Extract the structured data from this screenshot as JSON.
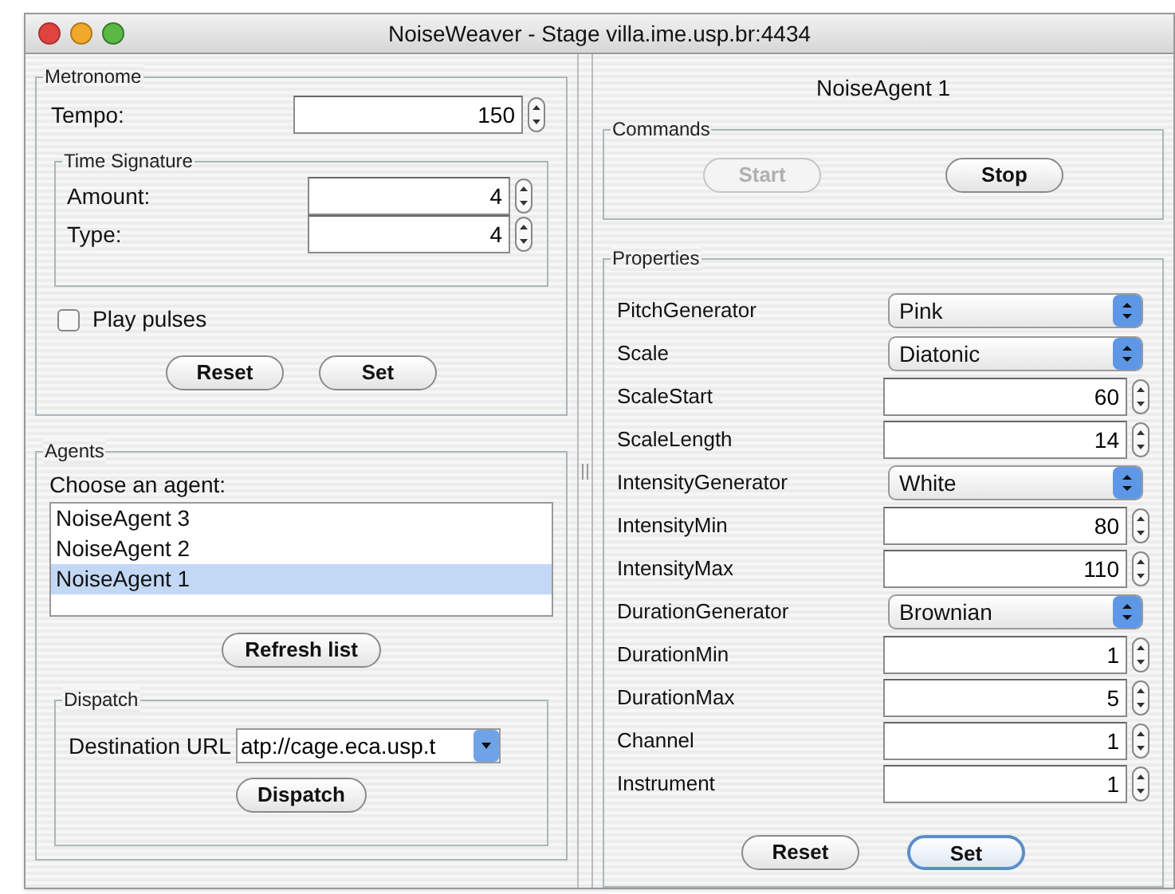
{
  "window": {
    "title": "NoiseWeaver - Stage villa.ime.usp.br:4434"
  },
  "metronome": {
    "title": "Metronome",
    "tempo": {
      "label": "Tempo:",
      "value": "150"
    },
    "time_signature": {
      "title": "Time Signature",
      "fields": [
        {
          "label": "Amount:",
          "value": "4"
        },
        {
          "label": "Type:",
          "value": "4"
        }
      ]
    },
    "play_pulses": {
      "label": "Play pulses",
      "checked": false
    },
    "buttons": [
      {
        "label": "Reset",
        "default": false
      },
      {
        "label": "Set",
        "default": false
      }
    ]
  },
  "agents": {
    "title": "Agents",
    "list_label": "Choose an agent:",
    "items": [
      {
        "label": "NoiseAgent 3",
        "selected": false
      },
      {
        "label": "NoiseAgent 2",
        "selected": false
      },
      {
        "label": "NoiseAgent 1",
        "selected": true
      }
    ],
    "refresh_button": "Refresh list",
    "dispatch": {
      "title": "Dispatch",
      "url_label": "Destination URL",
      "url_value": "atp://cage.eca.usp.t",
      "button": "Dispatch"
    }
  },
  "agent_panel": {
    "title": "NoiseAgent 1",
    "commands": {
      "title": "Commands",
      "buttons": [
        {
          "label": "Start",
          "disabled": true
        },
        {
          "label": "Stop",
          "disabled": false
        }
      ]
    },
    "properties": {
      "title": "Properties",
      "rows": [
        {
          "label": "PitchGenerator",
          "kind": "select",
          "value": "Pink"
        },
        {
          "label": "Scale",
          "kind": "select",
          "value": "Diatonic"
        },
        {
          "label": "ScaleStart",
          "kind": "spinner",
          "value": "60"
        },
        {
          "label": "ScaleLength",
          "kind": "spinner",
          "value": "14"
        },
        {
          "label": "IntensityGenerator",
          "kind": "select",
          "value": "White"
        },
        {
          "label": "IntensityMin",
          "kind": "spinner",
          "value": "80"
        },
        {
          "label": "IntensityMax",
          "kind": "spinner",
          "value": "110"
        },
        {
          "label": "DurationGenerator",
          "kind": "select",
          "value": "Brownian"
        },
        {
          "label": "DurationMin",
          "kind": "spinner",
          "value": "1"
        },
        {
          "label": "DurationMax",
          "kind": "spinner",
          "value": "5"
        },
        {
          "label": "Channel",
          "kind": "spinner",
          "value": "1"
        },
        {
          "label": "Instrument",
          "kind": "spinner",
          "value": "1"
        }
      ],
      "buttons": [
        {
          "label": "Reset",
          "default": false
        },
        {
          "label": "Set",
          "default": true
        }
      ]
    }
  }
}
